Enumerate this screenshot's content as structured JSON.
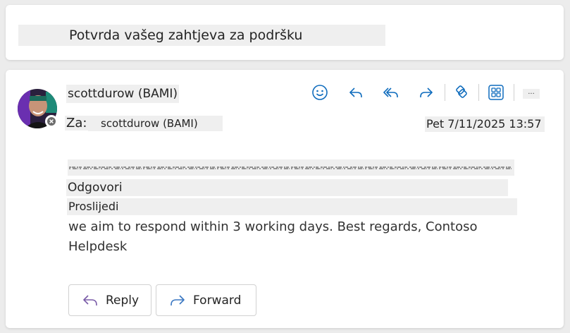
{
  "subject": "Potvrda vašeg zahtjeva za podršku",
  "sender": {
    "name": "scottdurow (BAMI)"
  },
  "recipients": {
    "label": "Za:",
    "value": "scottdurow (BAMI)"
  },
  "date": "Pet 7/11/2025 13:57",
  "toolbar": {
    "emoji_icon": "emoji-icon",
    "reply_icon": "reply-icon",
    "reply_all_icon": "reply-all-icon",
    "forward_icon": "forward-icon",
    "loop_icon": "loop-icon",
    "apps_icon": "apps-icon",
    "more_label": "..."
  },
  "body": {
    "reply_word": "Odgovori",
    "forward_word": "Proslijedi",
    "text": "we aim to respond within 3 working days. Best regards, Contoso Helpdesk"
  },
  "actions": {
    "reply": "Reply",
    "forward": "Forward"
  },
  "colors": {
    "accent": "#0f6cbd",
    "button_icon": "#7a5ca8",
    "forward_icon": "#3a77c2"
  }
}
